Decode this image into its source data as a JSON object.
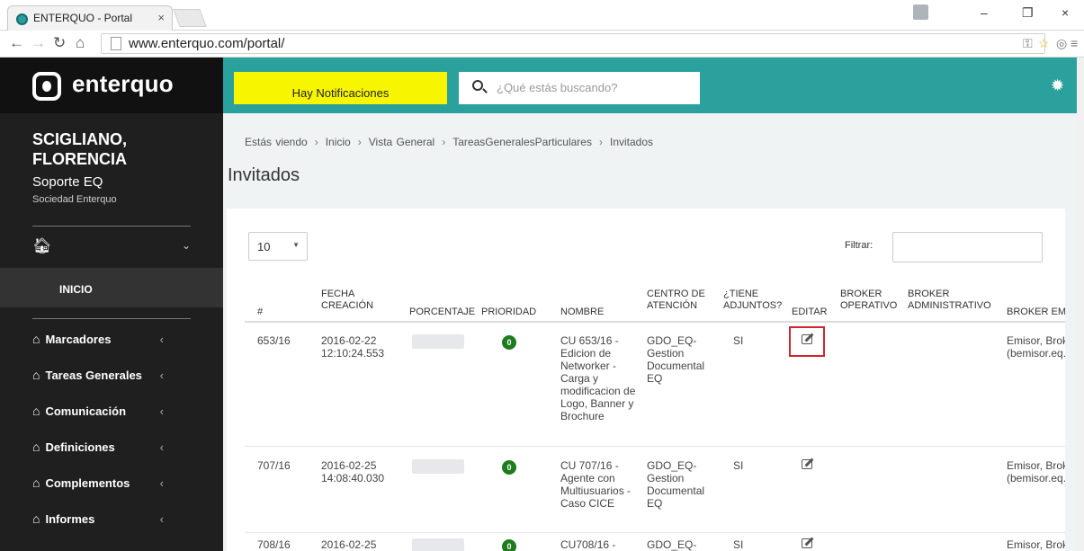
{
  "browser": {
    "tab_title": "ENTERQUO - Portal",
    "tab_close": "×",
    "url": "www.enterquo.com/portal/",
    "min": "–",
    "max": "❐",
    "close": "×"
  },
  "header": {
    "logo_text": "enterquo",
    "notification_label": "Hay Notificaciones",
    "search_placeholder": "¿Qué estás buscando?"
  },
  "sidebar": {
    "user_name": "SCIGLIANO, FLORENCIA",
    "user_role": "Soporte EQ",
    "company": "Sociedad Enterquo",
    "active_item": "INICIO",
    "items": [
      {
        "label": "Marcadores"
      },
      {
        "label": "Tareas Generales"
      },
      {
        "label": "Comunicación"
      },
      {
        "label": "Definiciones"
      },
      {
        "label": "Complementos"
      },
      {
        "label": "Informes"
      }
    ]
  },
  "main": {
    "breadcrumb": {
      "prefix": "Estás viendo",
      "items": [
        "Inicio",
        "Vista General",
        "TareasGeneralesParticulares",
        "Invitados"
      ]
    },
    "title": "Invitados",
    "page_length": "10",
    "filter_label": "Filtrar:",
    "columns": [
      "#",
      "FECHA CREACIÓN",
      "PORCENTAJE",
      "PRIORIDAD",
      "NOMBRE",
      "CENTRO DE ATENCIÓN",
      "¿TIENE ADJUNTOS?",
      "EDITAR",
      "BROKER OPERATIVO",
      "BROKER ADMINISTRATIVO",
      "BROKER EMISO"
    ],
    "rows": [
      {
        "id": "653/16",
        "date": "2016-02-22",
        "time": "12:10:24.553",
        "priority": "0",
        "name": "CU 653/16 - Edicion de Networker - Carga y modificacion de Logo, Banner y Brochure",
        "center": "GDO_EQ- Gestion Documental EQ",
        "attachments": "SI",
        "emisor_1": "Emisor, Broke",
        "emisor_2": "(bemisor.eq.g"
      },
      {
        "id": "707/16",
        "date": "2016-02-25",
        "time": "14:08:40.030",
        "priority": "0",
        "name": "CU 707/16 - Agente con Multiusuarios - Caso CICE",
        "center": "GDO_EQ- Gestion Documental EQ",
        "attachments": "SI",
        "emisor_1": "Emisor, Broke",
        "emisor_2": "(bemisor.eq.g"
      },
      {
        "id": "708/16",
        "date": "2016-02-25",
        "time": "",
        "priority": "0",
        "name": "CU708/16 -",
        "center": "GDO_EQ-",
        "attachments": "SI",
        "emisor_1": "Emisor, Broke",
        "emisor_2": ""
      }
    ]
  }
}
